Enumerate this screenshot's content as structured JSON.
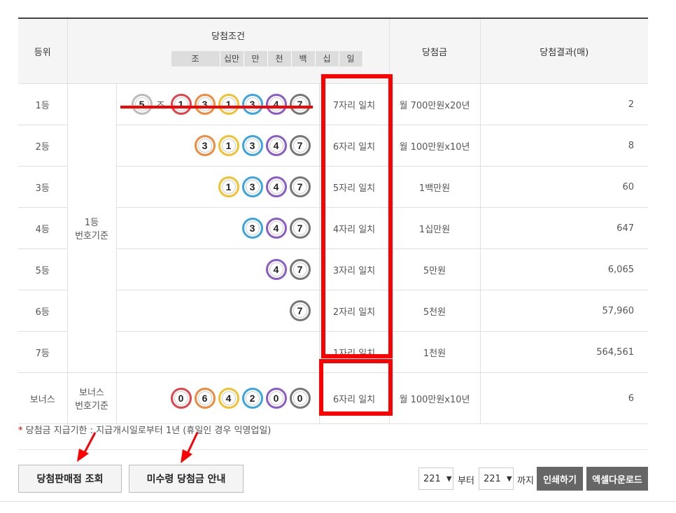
{
  "colors": {
    "red_ball": "#e2434b",
    "orange_ball": "#f08a3c",
    "yellow_ball": "#f2c12e",
    "blue_ball": "#3aa6e0",
    "purple_ball": "#8b5cc7",
    "gray_ball": "#777777",
    "highlight": "#ff0000",
    "prize_text": "#b5331a"
  },
  "header": {
    "rank": "등위",
    "condition": "당첨조건",
    "digits": [
      "조",
      "십만",
      "만",
      "천",
      "백",
      "십",
      "일"
    ],
    "prize": "당첨금",
    "result": "당첨결과(매)"
  },
  "rows": [
    {
      "rank": "1등",
      "match": "7자리 일치",
      "prize": "월 700만원x20년",
      "count": "2"
    },
    {
      "rank": "2등",
      "match": "6자리 일치",
      "prize": "월 100만원x10년",
      "count": "8"
    },
    {
      "rank": "3등",
      "match": "5자리 일치",
      "prize": "1백만원",
      "count": "60"
    },
    {
      "rank": "4등",
      "match": "4자리 일치",
      "prize": "1십만원",
      "count": "647"
    },
    {
      "rank": "5등",
      "match": "3자리 일치",
      "prize": "5만원",
      "count": "6,065"
    },
    {
      "rank": "6등",
      "match": "2자리 일치",
      "prize": "5천원",
      "count": "57,960"
    },
    {
      "rank": "7등",
      "match": "1자리 일치",
      "prize": "1천원",
      "count": "564,561"
    }
  ],
  "basis_main": {
    "line1": "1등",
    "line2": "번호기준"
  },
  "jo_group": {
    "number": "5",
    "label": "조"
  },
  "main_numbers": [
    "1",
    "3",
    "1",
    "3",
    "4",
    "7"
  ],
  "bonus": {
    "rank": "보너스",
    "basis_line1": "보너스",
    "basis_line2": "번호기준",
    "numbers": [
      "0",
      "6",
      "4",
      "2",
      "0",
      "0"
    ],
    "match": "6자리 일치",
    "prize": "월 100만원x10년",
    "count": "6"
  },
  "note": {
    "star": "*",
    "text": " 당첨금 지급기한 : 지급개시일로부터 1년 (휴일인 경우 익영업일)"
  },
  "buttons": {
    "store": "당첨판매점 조회",
    "unclaimed": "미수령 당첨금 안내",
    "print": "인쇄하기",
    "excel": "엑셀다운로드"
  },
  "range": {
    "from": "221",
    "from_label": "부터",
    "to": "221",
    "to_label": "까지"
  }
}
